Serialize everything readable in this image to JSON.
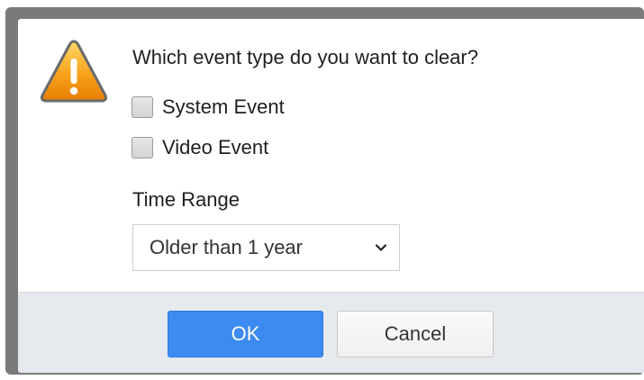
{
  "dialog": {
    "question": "Which event type do you want to clear?",
    "event_types": [
      {
        "label": "System Event",
        "checked": false
      },
      {
        "label": "Video Event",
        "checked": false
      }
    ],
    "time_range_label": "Time Range",
    "time_range_value": "Older than 1 year",
    "ok_label": "OK",
    "cancel_label": "Cancel",
    "icon": "warning-icon"
  },
  "colors": {
    "ok_button": "#3d8af0",
    "footer": "#e6e9ed",
    "warning": "#f59a0c"
  }
}
